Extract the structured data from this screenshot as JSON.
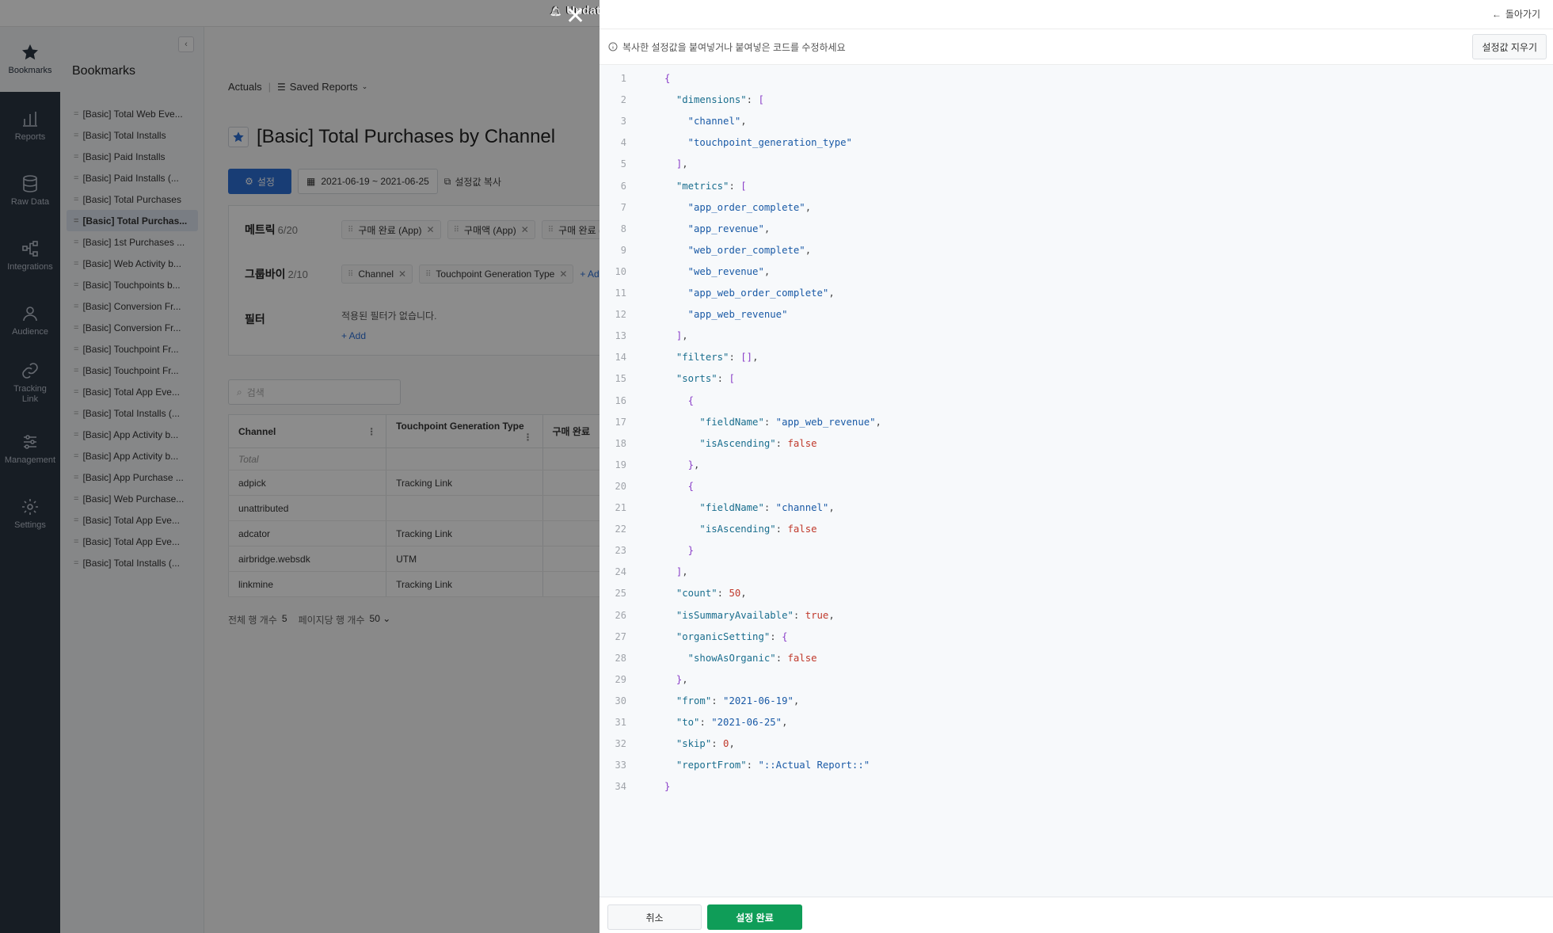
{
  "topbar": {
    "update_label": "Update"
  },
  "nav": {
    "items": [
      {
        "label": "Bookmarks",
        "icon": "star-icon"
      },
      {
        "label": "Reports",
        "icon": "bar-chart-icon"
      },
      {
        "label": "Raw Data",
        "icon": "database-icon"
      },
      {
        "label": "Integrations",
        "icon": "integrations-icon"
      },
      {
        "label": "Audience",
        "icon": "users-icon"
      },
      {
        "label": "Tracking\nLink",
        "icon": "link-icon"
      },
      {
        "label": "Management",
        "icon": "sliders-icon"
      },
      {
        "label": "Settings",
        "icon": "gear-icon"
      }
    ]
  },
  "bookmarks": {
    "title": "Bookmarks",
    "collapse_glyph": "‹",
    "items": [
      "[Basic] Total Web Eve...",
      "[Basic] Total Installs",
      "[Basic] Paid Installs",
      "[Basic] Paid Installs (...",
      "[Basic] Total Purchases",
      "[Basic] Total Purchas...",
      "[Basic] 1st Purchases ...",
      "[Basic] Web Activity b...",
      "[Basic] Touchpoints b...",
      "[Basic] Conversion Fr...",
      "[Basic] Conversion Fr...",
      "[Basic] Touchpoint Fr...",
      "[Basic] Touchpoint Fr...",
      "[Basic] Total App Eve...",
      "[Basic] Total Installs (...",
      "[Basic] App Activity b...",
      "[Basic] App Activity b...",
      "[Basic] App Purchase ...",
      "[Basic] Web Purchase...",
      "[Basic] Total App Eve...",
      "[Basic] Total App Eve...",
      "[Basic] Total Installs (..."
    ],
    "active_index": 5
  },
  "main": {
    "breadcrumb_actuals": "Actuals",
    "breadcrumb_sep": "|",
    "saved_reports": "Saved Reports",
    "title": "[Basic] Total Purchases by Channel",
    "settings_btn": "설정",
    "date_range": "2021-06-19 ~ 2021-06-25",
    "copy_settings": "설정값 복사",
    "metrics_label": "메트릭",
    "metrics_count": "6/20",
    "metric_chips": [
      "구매 완료 (App)",
      "구매액 (App)",
      "구매 완료 (W"
    ],
    "groupby_label": "그룹바이",
    "groupby_count": "2/10",
    "groupby_chips": [
      "Channel",
      "Touchpoint Generation Type"
    ],
    "groupby_add": "+ Add",
    "filter_label": "필터",
    "no_filter": "적용된 필터가 없습니다.",
    "filter_add": "+ Add",
    "search_placeholder": "검색",
    "table": {
      "headers": [
        "Channel",
        "Touchpoint Generation Type",
        "구매 완료"
      ],
      "total_label": "Total",
      "rows": [
        [
          "adpick",
          "Tracking Link"
        ],
        [
          "unattributed",
          ""
        ],
        [
          "adcator",
          "Tracking Link"
        ],
        [
          "airbridge.websdk",
          "UTM"
        ],
        [
          "linkmine",
          "Tracking Link"
        ]
      ]
    },
    "total_rows_label": "전체 행 개수",
    "total_rows": "5",
    "per_page_label": "페이지당 행 개수",
    "per_page": "50"
  },
  "drawer": {
    "back_label": "돌아가기",
    "info": "복사한 설정값을 붙여넣거나 붙여넣은 코드를 수정하세요",
    "clear_btn": "설정값 지우기",
    "cancel_btn": "취소",
    "confirm_btn": "설정 완료",
    "code_lines": [
      "{",
      "  \"dimensions\": [",
      "    \"channel\",",
      "    \"touchpoint_generation_type\"",
      "  ],",
      "  \"metrics\": [",
      "    \"app_order_complete\",",
      "    \"app_revenue\",",
      "    \"web_order_complete\",",
      "    \"web_revenue\",",
      "    \"app_web_order_complete\",",
      "    \"app_web_revenue\"",
      "  ],",
      "  \"filters\": [],",
      "  \"sorts\": [",
      "    {",
      "      \"fieldName\": \"app_web_revenue\",",
      "      \"isAscending\": false",
      "    },",
      "    {",
      "      \"fieldName\": \"channel\",",
      "      \"isAscending\": false",
      "    }",
      "  ],",
      "  \"count\": 50,",
      "  \"isSummaryAvailable\": true,",
      "  \"organicSetting\": {",
      "    \"showAsOrganic\": false",
      "  },",
      "  \"from\": \"2021-06-19\",",
      "  \"to\": \"2021-06-25\",",
      "  \"skip\": 0,",
      "  \"reportFrom\": \"::Actual Report::\"",
      "}"
    ]
  },
  "colors": {
    "accent": "#2c6fd6",
    "confirm": "#0f9d58",
    "nav_bg": "#2b3543"
  }
}
